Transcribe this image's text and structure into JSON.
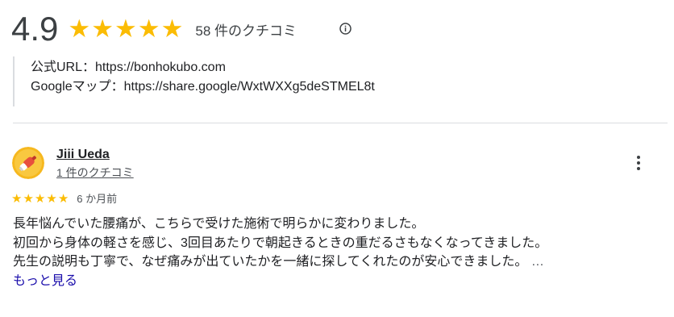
{
  "summary": {
    "rating": "4.9",
    "stars_filled": 5,
    "stars_total": 5,
    "review_count_text": "58 件のクチコミ"
  },
  "prev_review": {
    "line1": "公式URL：https://bonhokubo.com",
    "line2": "Googleマップ：https://share.google/WxtWXXg5deSTMEL8t"
  },
  "review": {
    "reviewer_name": "Jiii Ueda",
    "reviewer_count": "1 件のクチコミ",
    "stars_filled": 5,
    "date": "6 か月前",
    "text_line1": "長年悩んでいた腰痛が、こちらで受けた施術で明らかに変わりました。",
    "text_line2": "初回から身体の軽さを感じ、3回目あたりで朝起きるときの重だるさもなくなってきました。",
    "text_line3": "先生の説明も丁寧で、なぜ痛みが出ていたかを一緒に探してくれたのが安心できました。",
    "ellipsis": " …",
    "more_link": "もっと見る"
  },
  "colors": {
    "star": "#fbbc04",
    "link": "#1a0dab",
    "divider": "#dadce0"
  },
  "icons": {
    "info": "info-icon",
    "more": "more-vert-icon",
    "star": "star-icon",
    "avatar": "avatar"
  }
}
